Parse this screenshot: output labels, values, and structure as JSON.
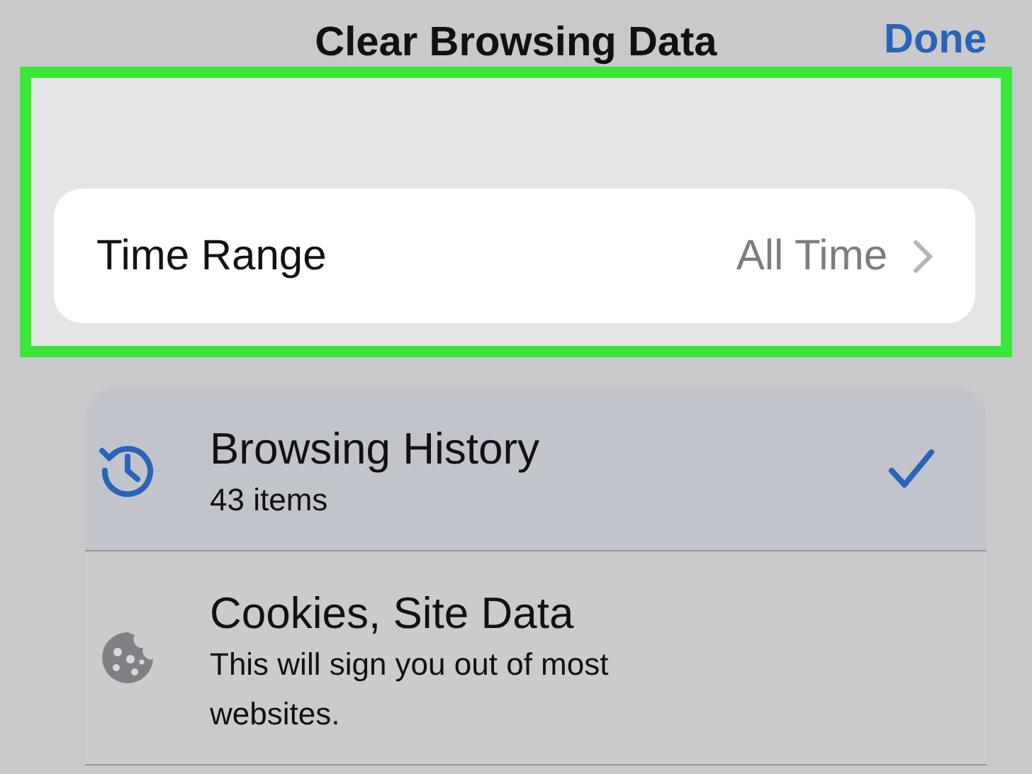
{
  "nav": {
    "title": "Clear Browsing Data",
    "done": "Done"
  },
  "time_range": {
    "label": "Time Range",
    "value": "All Time",
    "highlighted": true
  },
  "items": [
    {
      "kind": "history",
      "title": "Browsing History",
      "subtitle": "43 items",
      "checked": true
    },
    {
      "kind": "cookies",
      "title": "Cookies, Site Data",
      "subtitle": "This will sign you out of most websites.",
      "checked": false
    }
  ]
}
